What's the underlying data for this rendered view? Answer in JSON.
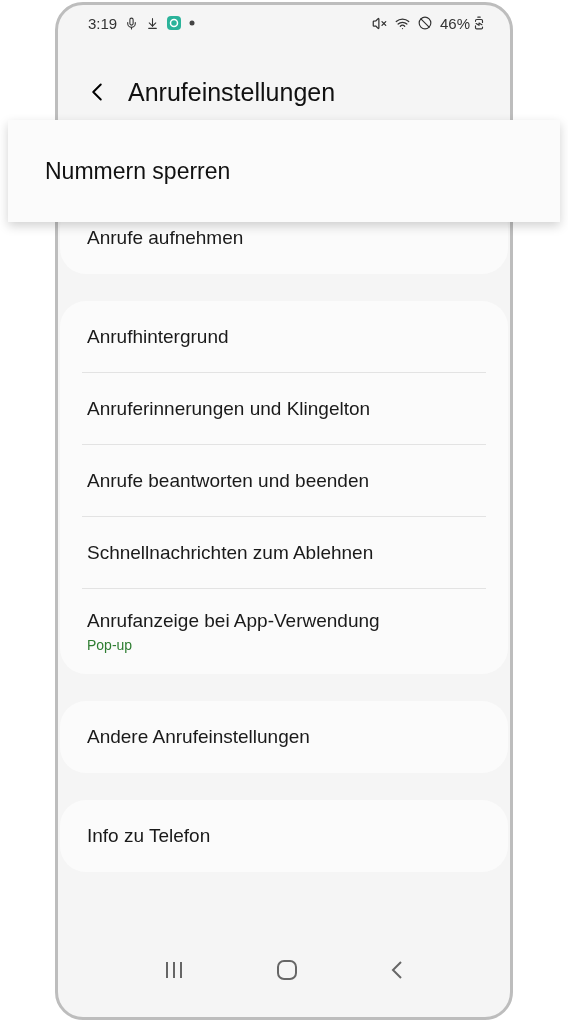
{
  "status_bar": {
    "time": "3:19",
    "battery": "46%"
  },
  "header": {
    "title": "Anrufeinstellungen"
  },
  "highlight": {
    "label": "Nummern sperren"
  },
  "groups": [
    {
      "items": [
        {
          "label": "Anrufe aufnehmen"
        }
      ]
    },
    {
      "items": [
        {
          "label": "Anrufhintergrund"
        },
        {
          "label": "Anruferinnerungen und Klingelton"
        },
        {
          "label": "Anrufe beantworten und beenden"
        },
        {
          "label": "Schnellnachrichten zum Ablehnen"
        },
        {
          "label": "Anrufanzeige bei App-Verwendung",
          "sub": "Pop-up"
        }
      ]
    },
    {
      "items": [
        {
          "label": "Andere Anrufeinstellungen"
        }
      ]
    },
    {
      "items": [
        {
          "label": "Info zu Telefon"
        }
      ]
    }
  ]
}
